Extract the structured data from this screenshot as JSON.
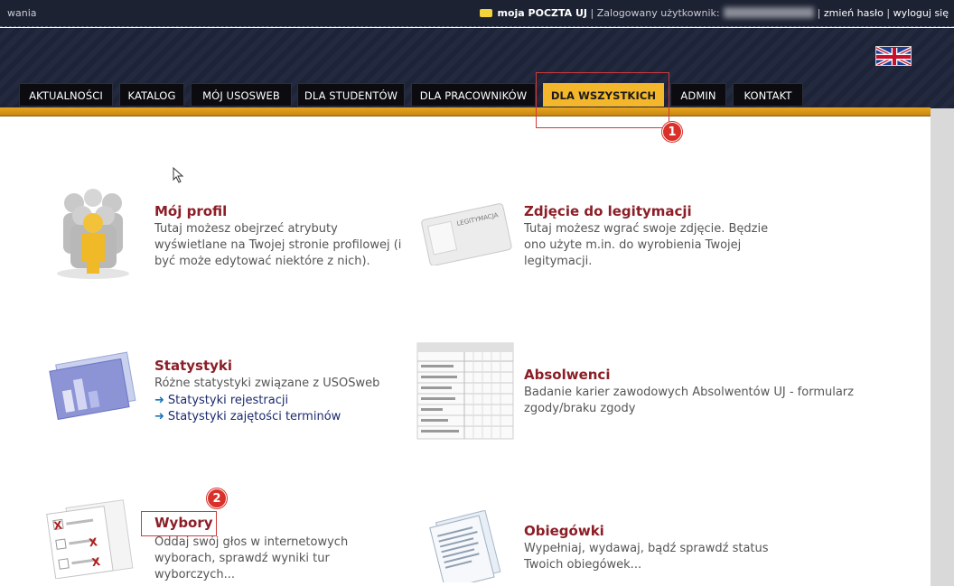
{
  "topbar": {
    "left_text": "wania",
    "mail_label": "moja POCZTA UJ",
    "separator": "|",
    "logged_user_label": "Zalogowany użytkownik:",
    "change_password": "zmień hasło",
    "logout": "wyloguj się"
  },
  "nav": {
    "tabs": [
      {
        "label": "AKTUALNOŚCI"
      },
      {
        "label": "KATALOG"
      },
      {
        "label": "MÓJ USOSWEB"
      },
      {
        "label": "DLA STUDENTÓW"
      },
      {
        "label": "DLA PRACOWNIKÓW"
      },
      {
        "label": "DLA WSZYSTKICH"
      },
      {
        "label": "ADMIN"
      },
      {
        "label": "KONTAKT"
      }
    ],
    "active_tab": "DLA WSZYSTKICH"
  },
  "annotations": {
    "badge1": "1",
    "badge2": "2"
  },
  "items": {
    "profile": {
      "title": "Mój profil",
      "desc1": "Tutaj możesz obejrzeć atrybuty",
      "desc2": "wyświetlane na Twojej stronie profilowej (i",
      "desc3": "być może edytować niektóre z nich)."
    },
    "photo": {
      "title": "Zdjęcie do legitymacji",
      "desc1": "Tutaj możesz wgrać swoje zdjęcie. Będzie",
      "desc2": "ono użyte m.in. do wyrobienia Twojej",
      "desc3": "legitymacji.",
      "card_text": "LEGITYMACJA"
    },
    "stats": {
      "title": "Statystyki",
      "desc1": "Różne statystyki związane z USOSweb",
      "link1": "Statystyki rejestracji",
      "link2": "Statystyki zajętości terminów"
    },
    "alumni": {
      "title": "Absolwenci",
      "desc1": "Badanie karier zawodowych Absolwentów UJ - formularz",
      "desc2": "zgody/braku zgody"
    },
    "elections": {
      "title": "Wybory",
      "desc1": "Oddaj swój głos w internetowych",
      "desc2": "wyborach, sprawdź wyniki tur",
      "desc3": "wyborczych..."
    },
    "circulars": {
      "title": "Obiegówki",
      "desc1": "Wypełniaj, wydawaj, bądź sprawdź status",
      "desc2": "Twoich obiegówek..."
    }
  },
  "colors": {
    "accent": "#f4b62a",
    "title": "#8b1e26",
    "annotation": "#d93029"
  }
}
